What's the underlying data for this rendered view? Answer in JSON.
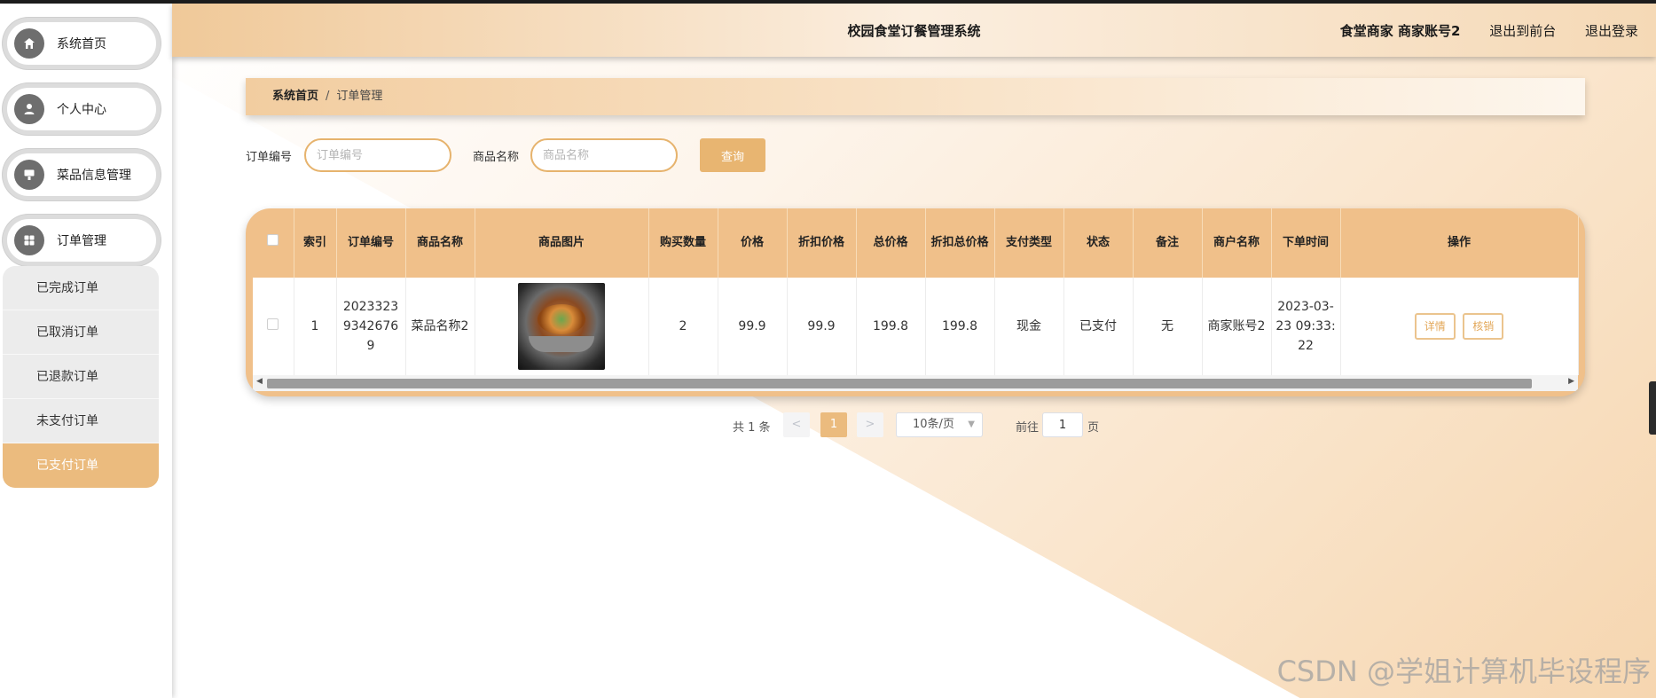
{
  "header": {
    "title": "校园食堂订餐管理系统",
    "user_label": "食堂商家 商家账号2",
    "front_link": "退出到前台",
    "logout_link": "退出登录"
  },
  "sidebar": {
    "items": [
      {
        "label": "系统首页",
        "icon": "home-icon"
      },
      {
        "label": "个人中心",
        "icon": "user-icon"
      },
      {
        "label": "菜品信息管理",
        "icon": "dish-icon"
      },
      {
        "label": "订单管理",
        "icon": "grid-icon"
      }
    ],
    "sub_items": [
      {
        "label": "已完成订单",
        "active": false
      },
      {
        "label": "已取消订单",
        "active": false
      },
      {
        "label": "已退款订单",
        "active": false
      },
      {
        "label": "未支付订单",
        "active": false
      },
      {
        "label": "已支付订单",
        "active": true
      }
    ]
  },
  "breadcrumb": {
    "home": "系统首页",
    "separator": "/",
    "current": "订单管理"
  },
  "search": {
    "order_no_label": "订单编号",
    "order_no_placeholder": "订单编号",
    "product_label": "商品名称",
    "product_placeholder": "商品名称",
    "button_label": "查询"
  },
  "table": {
    "columns": [
      "",
      "索引",
      "订单编号",
      "商品名称",
      "商品图片",
      "购买数量",
      "价格",
      "折扣价格",
      "总价格",
      "折扣总价格",
      "支付类型",
      "状态",
      "备注",
      "商户名称",
      "下单时间",
      "操作"
    ],
    "rows": [
      {
        "index": "1",
        "order_no": "20233239342676 9",
        "product_name": "菜品名称2",
        "image": "dry-pot-dish",
        "quantity": "2",
        "price": "99.9",
        "discount_price": "99.9",
        "total": "199.8",
        "discount_total": "199.8",
        "pay_type": "现金",
        "status": "已支付",
        "remark": "无",
        "merchant": "商家账号2",
        "order_time": "2023-03-23 09:33:22",
        "detail_btn": "详情",
        "verify_btn": "核销"
      }
    ]
  },
  "pagination": {
    "total": "共 1 条",
    "prev": "<",
    "current": "1",
    "next": ">",
    "page_size": "10条/页",
    "goto_label": "前往",
    "goto_value": "1",
    "goto_suffix": "页"
  },
  "watermark": "CSDN @学姐计算机毕设程序",
  "colors": {
    "accent": "#ebbb7e",
    "button": "#e8b571",
    "table_header": "#f0c08a"
  }
}
